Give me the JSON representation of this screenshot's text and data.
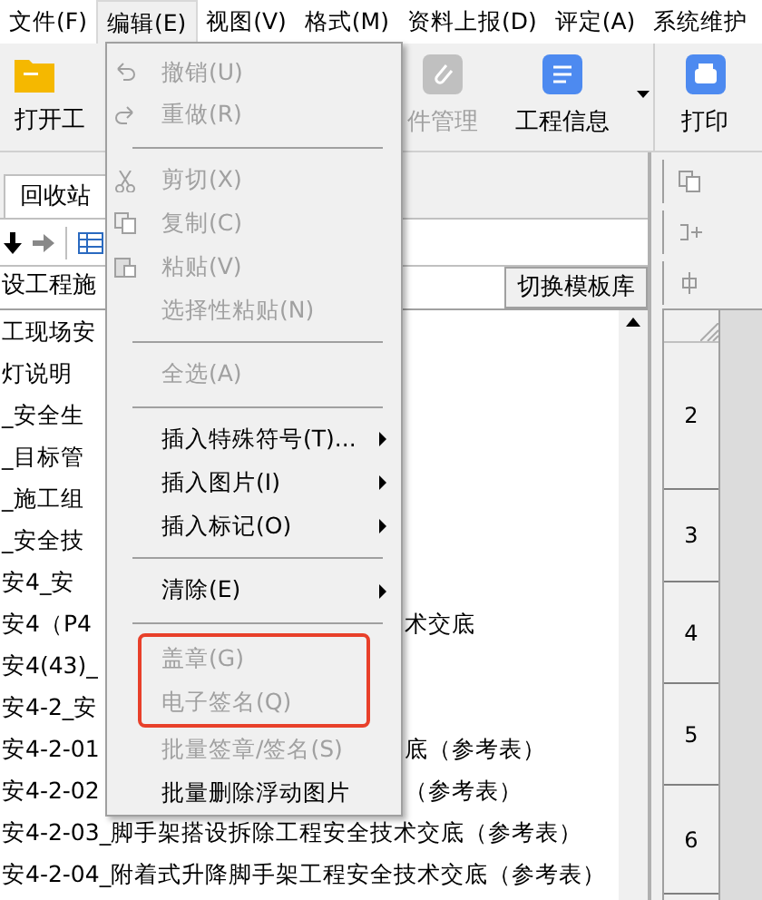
{
  "menu_bar": [
    {
      "label": "文件(F)",
      "selected": false
    },
    {
      "label": "编辑(E)",
      "selected": true
    },
    {
      "label": "视图(V)",
      "selected": false
    },
    {
      "label": "格式(M)",
      "selected": false
    },
    {
      "label": "资料上报(D)",
      "selected": false
    },
    {
      "label": "评定(A)",
      "selected": false
    },
    {
      "label": "系统维护",
      "selected": false
    }
  ],
  "toolbar": [
    {
      "label": "打开工",
      "kind": "folder",
      "disabled": false
    },
    {
      "label": "件管理",
      "kind": "attach",
      "disabled": true
    },
    {
      "label": "工程信息",
      "kind": "info",
      "disabled": false,
      "dropdown": true
    },
    {
      "label": "打印",
      "kind": "print",
      "disabled": false
    }
  ],
  "left_panel": {
    "tab": "回收站",
    "template_field": "设工程施",
    "switch_button": "切换模板库",
    "tree": [
      {
        "text": "工现场安"
      },
      {
        "text": "灯说明"
      },
      {
        "text": "_安全生"
      },
      {
        "text": "_目标管"
      },
      {
        "text": "_施工组"
      },
      {
        "text": "_安全技"
      },
      {
        "text": "安4_安"
      },
      {
        "text": "安4（P4",
        "tail": "术交底"
      },
      {
        "text": "安4(43)_"
      },
      {
        "text": "安4-2_安"
      },
      {
        "text": "安4-2-01",
        "tail": "底（参考表）"
      },
      {
        "text": "安4-2-02",
        "tail": "（参考表）"
      },
      {
        "text": "安4-2-03_脚手架搭设拆除工程安全技术交底（参考表）"
      },
      {
        "text": "安4-2-04_附着式升降脚手架工程安全技术交底（参考表）"
      }
    ]
  },
  "edit_menu": [
    {
      "kind": "item",
      "label": "撤销(U)",
      "disabled": true
    },
    {
      "kind": "item",
      "label": "重做(R)",
      "disabled": true
    },
    {
      "kind": "separator"
    },
    {
      "kind": "item",
      "label": "剪切(X)",
      "disabled": true
    },
    {
      "kind": "item",
      "label": "复制(C)",
      "disabled": true
    },
    {
      "kind": "item",
      "label": "粘贴(V)",
      "disabled": true
    },
    {
      "kind": "item",
      "label": "选择性粘贴(N)",
      "disabled": true
    },
    {
      "kind": "separator"
    },
    {
      "kind": "item",
      "label": "全选(A)",
      "disabled": true
    },
    {
      "kind": "separator"
    },
    {
      "kind": "item",
      "label": "插入特殊符号(T)...",
      "disabled": false,
      "submenu": true
    },
    {
      "kind": "item",
      "label": "插入图片(I)",
      "disabled": false,
      "submenu": true
    },
    {
      "kind": "item",
      "label": "插入标记(O)",
      "disabled": false,
      "submenu": true
    },
    {
      "kind": "separator"
    },
    {
      "kind": "item",
      "label": "清除(E)",
      "disabled": false,
      "submenu": true
    },
    {
      "kind": "separator"
    },
    {
      "kind": "item",
      "label": "盖章(G)",
      "disabled": true,
      "boxed": true
    },
    {
      "kind": "item",
      "label": "电子签名(Q)",
      "disabled": true,
      "boxed": true
    },
    {
      "kind": "item",
      "label": "批量签章/签名(S)",
      "disabled": true
    },
    {
      "kind": "item",
      "label": "批量删除浮动图片",
      "disabled": false
    }
  ],
  "sheet": {
    "row_numbers": [
      "2",
      "3",
      "4",
      "5",
      "6"
    ]
  }
}
